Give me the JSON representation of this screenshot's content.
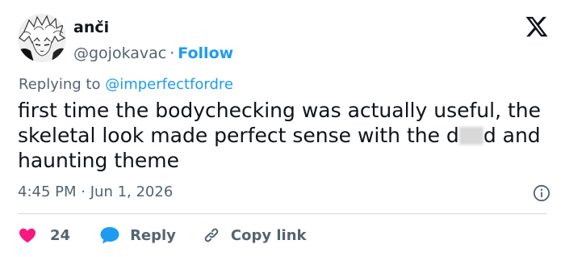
{
  "tweet": {
    "display_name": "anči",
    "handle": "@gojokavac",
    "separator": "·",
    "follow_label": "Follow",
    "replying_prefix": "Replying to",
    "replying_to": "@imperfectfordre",
    "text_before_censor": "first time the bodychecking was actually useful, the skeletal look made perfect sense with the d",
    "text_after_censor": "d and haunting theme",
    "time": "4:45 PM",
    "date": "Jun 1, 2026",
    "like_count": "24",
    "reply_label": "Reply",
    "copy_link_label": "Copy link"
  },
  "icons": {
    "logo": "x-logo-icon",
    "info": "info-icon",
    "like": "heart-icon",
    "reply": "speech-bubble-icon",
    "copy": "link-icon"
  },
  "colors": {
    "accent": "#1d9bf0",
    "like": "#f91880",
    "text": "#0f1419",
    "muted": "#536471",
    "divider": "#cfd9de"
  }
}
